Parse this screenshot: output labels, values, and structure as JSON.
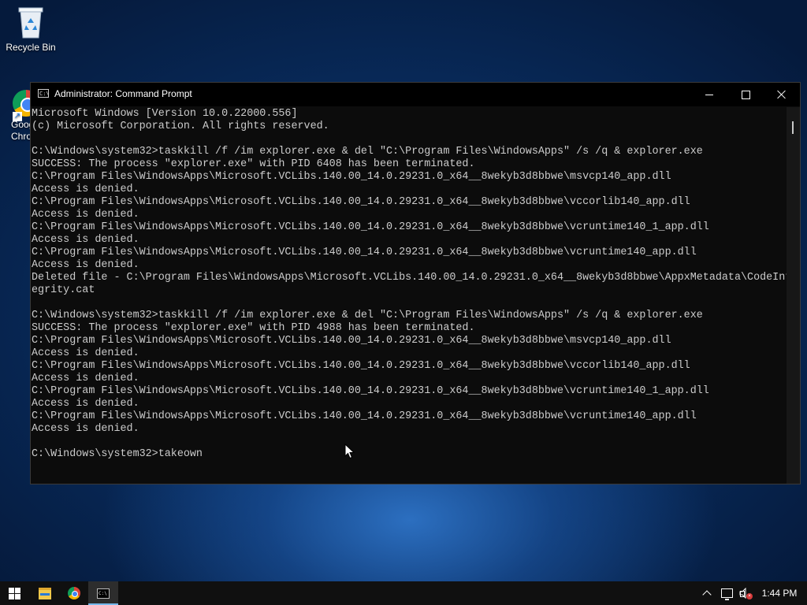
{
  "desktop": {
    "icons": [
      {
        "label": "Recycle Bin",
        "icon": "recycle-bin-icon"
      },
      {
        "label": "Google\nChrome",
        "icon": "chrome-icon"
      }
    ]
  },
  "window": {
    "title": "Administrator: Command Prompt",
    "icon": "cmd-icon",
    "controls": {
      "minimize": "minimize-icon",
      "maximize": "maximize-icon",
      "close": "close-icon"
    }
  },
  "console": {
    "lines": [
      "Microsoft Windows [Version 10.0.22000.556]",
      "(c) Microsoft Corporation. All rights reserved.",
      "",
      "C:\\Windows\\system32>taskkill /f /im explorer.exe & del \"C:\\Program Files\\WindowsApps\" /s /q & explorer.exe",
      "SUCCESS: The process \"explorer.exe\" with PID 6408 has been terminated.",
      "C:\\Program Files\\WindowsApps\\Microsoft.VCLibs.140.00_14.0.29231.0_x64__8wekyb3d8bbwe\\msvcp140_app.dll",
      "Access is denied.",
      "C:\\Program Files\\WindowsApps\\Microsoft.VCLibs.140.00_14.0.29231.0_x64__8wekyb3d8bbwe\\vccorlib140_app.dll",
      "Access is denied.",
      "C:\\Program Files\\WindowsApps\\Microsoft.VCLibs.140.00_14.0.29231.0_x64__8wekyb3d8bbwe\\vcruntime140_1_app.dll",
      "Access is denied.",
      "C:\\Program Files\\WindowsApps\\Microsoft.VCLibs.140.00_14.0.29231.0_x64__8wekyb3d8bbwe\\vcruntime140_app.dll",
      "Access is denied.",
      "Deleted file - C:\\Program Files\\WindowsApps\\Microsoft.VCLibs.140.00_14.0.29231.0_x64__8wekyb3d8bbwe\\AppxMetadata\\CodeInt",
      "egrity.cat",
      "",
      "C:\\Windows\\system32>taskkill /f /im explorer.exe & del \"C:\\Program Files\\WindowsApps\" /s /q & explorer.exe",
      "SUCCESS: The process \"explorer.exe\" with PID 4988 has been terminated.",
      "C:\\Program Files\\WindowsApps\\Microsoft.VCLibs.140.00_14.0.29231.0_x64__8wekyb3d8bbwe\\msvcp140_app.dll",
      "Access is denied.",
      "C:\\Program Files\\WindowsApps\\Microsoft.VCLibs.140.00_14.0.29231.0_x64__8wekyb3d8bbwe\\vccorlib140_app.dll",
      "Access is denied.",
      "C:\\Program Files\\WindowsApps\\Microsoft.VCLibs.140.00_14.0.29231.0_x64__8wekyb3d8bbwe\\vcruntime140_1_app.dll",
      "Access is denied.",
      "C:\\Program Files\\WindowsApps\\Microsoft.VCLibs.140.00_14.0.29231.0_x64__8wekyb3d8bbwe\\vcruntime140_app.dll",
      "Access is denied.",
      "",
      "C:\\Windows\\system32>takeown"
    ],
    "text_color": "#cccccc",
    "background": "#0c0c0c"
  },
  "taskbar": {
    "items": [
      {
        "name": "start",
        "icon": "windows-logo-icon"
      },
      {
        "name": "file-explorer",
        "icon": "folder-icon"
      },
      {
        "name": "chrome",
        "icon": "chrome-icon"
      },
      {
        "name": "command-prompt",
        "icon": "cmd-icon",
        "active": true
      }
    ],
    "tray": {
      "icons": [
        "chevron-up-icon",
        "network-icon",
        "volume-muted-icon"
      ],
      "clock": "1:44 PM"
    }
  }
}
